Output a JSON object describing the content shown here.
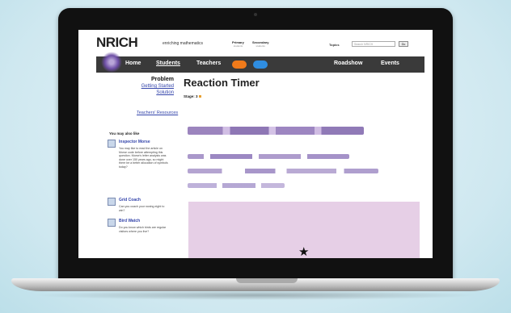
{
  "header": {
    "logo": "NRICH",
    "tagline": "enriching mathematics",
    "stage_primary": "Primary",
    "stage_primary_sub": "students",
    "stage_secondary": "Secondary",
    "stage_secondary_sub": "students",
    "topics_label": "Topics",
    "search_placeholder": "Search NRICH",
    "go_label": "Go"
  },
  "nav": {
    "items": [
      "Home",
      "Students",
      "Teachers",
      "Roadshow",
      "Events"
    ],
    "active": "Students"
  },
  "sidebar": {
    "problem_label": "Problem",
    "links": [
      "Getting Started",
      "Solution"
    ],
    "teachers_resources": "Teachers' Resources",
    "may_also_like": "You may also like",
    "related": [
      {
        "title": "Inspector Morse",
        "desc": "You may like to read the article on Morse code before attempting this question. Morse's letter analysis was done over 150 years ago, so might there be a better allocation of symbols today?"
      },
      {
        "title": "Grid Coach",
        "desc": "Can you coach your rowing eight to win?"
      },
      {
        "title": "Bird Watch",
        "desc": "Do you know which birds are regular visitors where you live?"
      }
    ]
  },
  "main": {
    "title": "Reaction Timer",
    "stage_label": "Stage: 3"
  },
  "colors": {
    "nav_bg": "#3a3a3a",
    "pill_orange": "#f07a1a",
    "pill_blue": "#2f8de0",
    "panel": "#e6cfe6",
    "link": "#3344aa"
  }
}
